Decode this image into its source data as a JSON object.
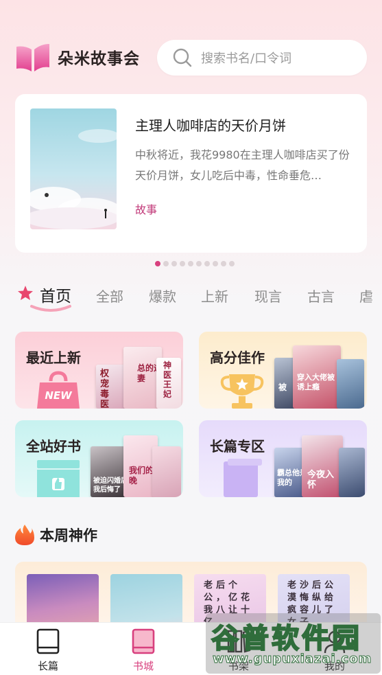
{
  "header": {
    "app_title": "朵米故事会",
    "search_placeholder": "搜索书名/口令词"
  },
  "featured": {
    "title": "主理人咖啡店的天价月饼",
    "description": "中秋将近，我花9980在主理人咖啡店买了份天价月饼，女儿吃后中毒，性命垂危…",
    "tag": "故事",
    "carousel_count": 10,
    "carousel_active_index": 0
  },
  "tabs": [
    {
      "label": "首页",
      "active": true
    },
    {
      "label": "全部",
      "active": false
    },
    {
      "label": "爆款",
      "active": false
    },
    {
      "label": "上新",
      "active": false
    },
    {
      "label": "现言",
      "active": false
    },
    {
      "label": "古言",
      "active": false
    },
    {
      "label": "虐",
      "active": false
    }
  ],
  "categories": {
    "new": {
      "label": "最近上新",
      "badge": "NEW",
      "book_titles": [
        "权宠毒医",
        "总的迎妻",
        "神医王妃"
      ]
    },
    "high": {
      "label": "高分佳作",
      "book_titles": [
        "穿入大佬被诱上瘾",
        "被"
      ]
    },
    "good": {
      "label": "全站好书",
      "book_titles": [
        "被迫闪婚后我后悔了",
        "我们的晚"
      ]
    },
    "long": {
      "label": "长篇专区",
      "book_titles": [
        "霸总他是我的",
        "今夜入怀"
      ]
    }
  },
  "weekly": {
    "title": "本周神作",
    "books": [
      {
        "cover_text": ""
      },
      {
        "cover_text": ""
      },
      {
        "cover_text": "老后个公，亿花我八让十亿"
      },
      {
        "cover_text": "老沙后公漠悔纵给疯容儿了女子"
      }
    ]
  },
  "bottom_nav": [
    {
      "label": "长篇",
      "active": false
    },
    {
      "label": "书城",
      "active": true
    },
    {
      "label": "书架",
      "active": false
    },
    {
      "label": "我的",
      "active": false
    }
  ],
  "watermark": {
    "text": "谷普软件园",
    "url": "www.gupuxiazai.com"
  },
  "colors": {
    "accent": "#d8407e",
    "tag": "#c23b7a"
  }
}
